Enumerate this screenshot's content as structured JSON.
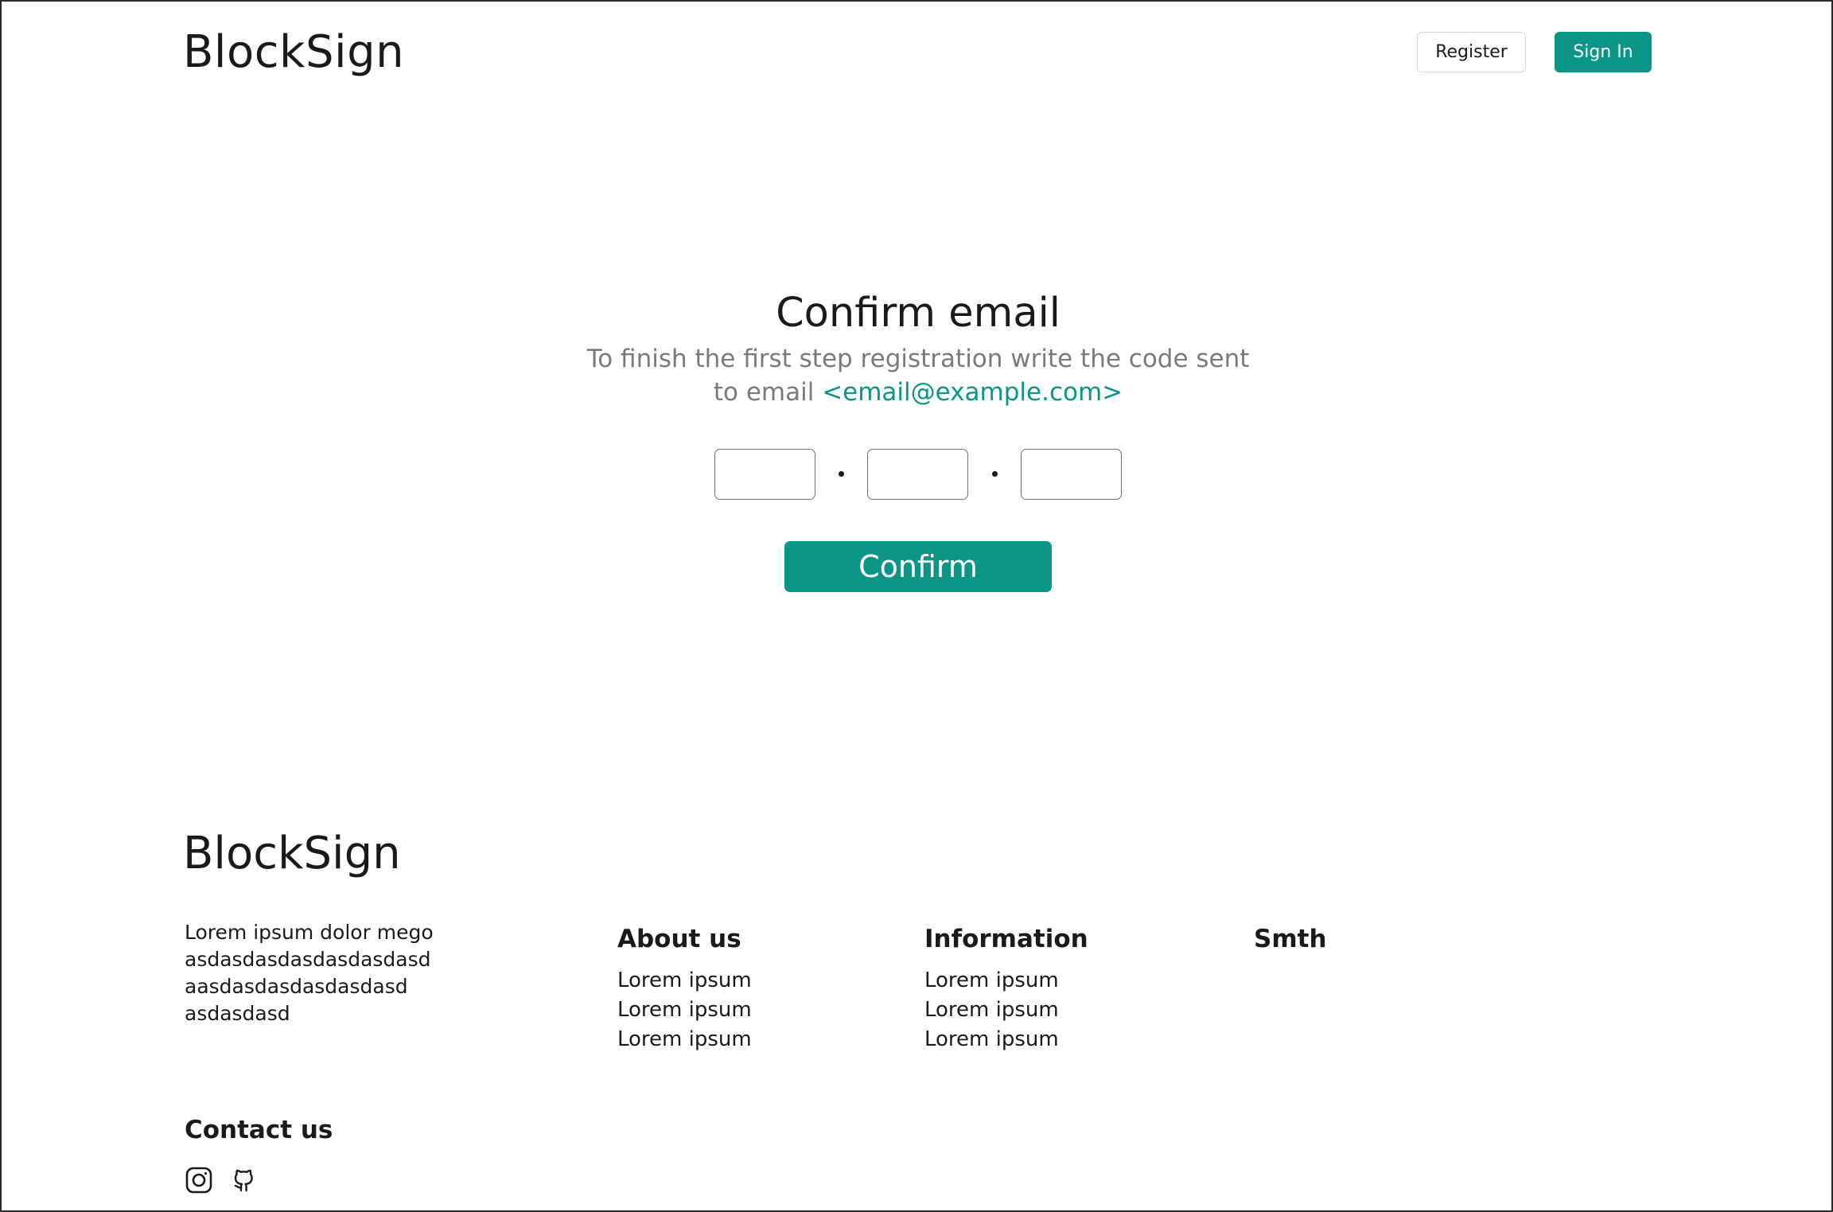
{
  "header": {
    "brand": "BlockSign",
    "register_label": "Register",
    "signin_label": "Sign In"
  },
  "confirm": {
    "title": "Confirm email",
    "subtitle_line1": "To finish the first step registration write the code sent",
    "subtitle_prefix": "to email ",
    "email": "<email@example.com>",
    "code": [
      [
        "",
        ""
      ],
      [
        "",
        ""
      ],
      [
        "",
        ""
      ]
    ],
    "button_label": "Confirm"
  },
  "footer": {
    "brand": "BlockSign",
    "description": "Lorem ipsum dolor mego\nasdasdasdasdasdasdasd\naasdasdasdasdasdasd\nasdasdasd",
    "columns": [
      {
        "title": "About us",
        "items": [
          "Lorem ipsum",
          "Lorem ipsum",
          "Lorem ipsum"
        ]
      },
      {
        "title": "Information",
        "items": [
          "Lorem ipsum",
          "Lorem ipsum",
          "Lorem ipsum"
        ]
      },
      {
        "title": "Smth",
        "items": []
      }
    ],
    "contact_title": "Contact us",
    "socials": [
      {
        "icon": "instagram-icon"
      },
      {
        "icon": "github-icon"
      }
    ]
  },
  "colors": {
    "accent": "#0a9587",
    "text": "#1a1a1a",
    "muted": "#7a7a7a",
    "border": "#6f6f6f"
  }
}
